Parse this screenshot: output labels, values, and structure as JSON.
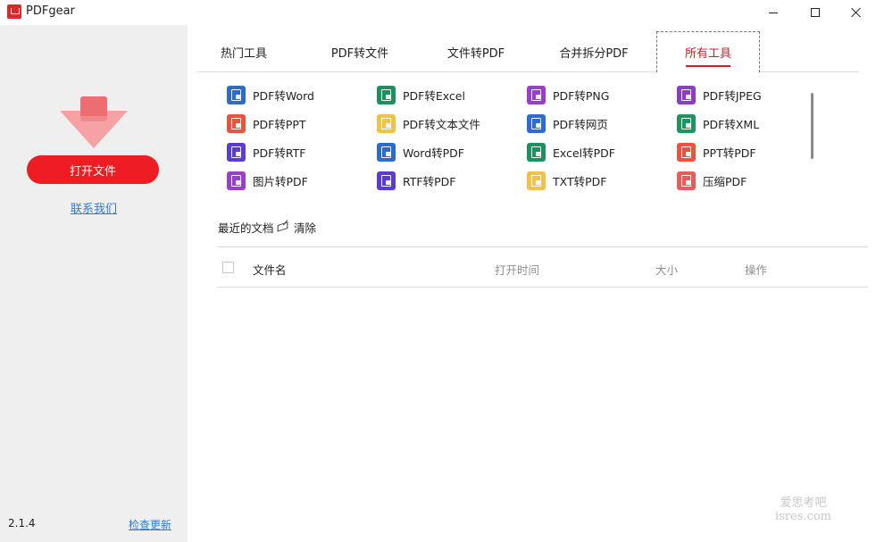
{
  "app": {
    "title": "PDFgear"
  },
  "sidebar": {
    "open_button": "打开文件",
    "contact_link": "联系我们",
    "version": "2.1.4",
    "update_link": "检查更新"
  },
  "tabs": [
    {
      "label": "热门工具"
    },
    {
      "label": "PDF转文件"
    },
    {
      "label": "文件转PDF"
    },
    {
      "label": "合并拆分PDF"
    },
    {
      "label": "所有工具"
    }
  ],
  "tools": [
    {
      "label": "PDF转Word",
      "color": "#2b6cc4"
    },
    {
      "label": "PDF转Excel",
      "color": "#1f8f5e"
    },
    {
      "label": "PDF转PNG",
      "color": "#9b3fc9"
    },
    {
      "label": "PDF转JPEG",
      "color": "#8e3cc0"
    },
    {
      "label": "PDF转PPT",
      "color": "#e8553c"
    },
    {
      "label": "PDF转文本文件",
      "color": "#f2c14a"
    },
    {
      "label": "PDF转网页",
      "color": "#2e6bd1"
    },
    {
      "label": "PDF转XML",
      "color": "#1f9460"
    },
    {
      "label": "PDF转RTF",
      "color": "#5b3ccf"
    },
    {
      "label": "Word转PDF",
      "color": "#2b6cc4"
    },
    {
      "label": "Excel转PDF",
      "color": "#1f8f5e"
    },
    {
      "label": "PPT转PDF",
      "color": "#e8553c"
    },
    {
      "label": "图片转PDF",
      "color": "#9b3fc9"
    },
    {
      "label": "RTF转PDF",
      "color": "#5b3ccf"
    },
    {
      "label": "TXT转PDF",
      "color": "#f2c14a"
    },
    {
      "label": "压缩PDF",
      "color": "#e85c5c"
    }
  ],
  "recent": {
    "title": "最近的文档",
    "clear": "清除",
    "columns": {
      "name": "文件名",
      "time": "打开时间",
      "size": "大小",
      "action": "操作"
    }
  },
  "watermark": {
    "line1": "爱思考吧",
    "line2": "isres.com"
  },
  "colors": {
    "accent": "#ee1d24",
    "link": "#2f7bd6",
    "active_tab": "#d21d22"
  }
}
